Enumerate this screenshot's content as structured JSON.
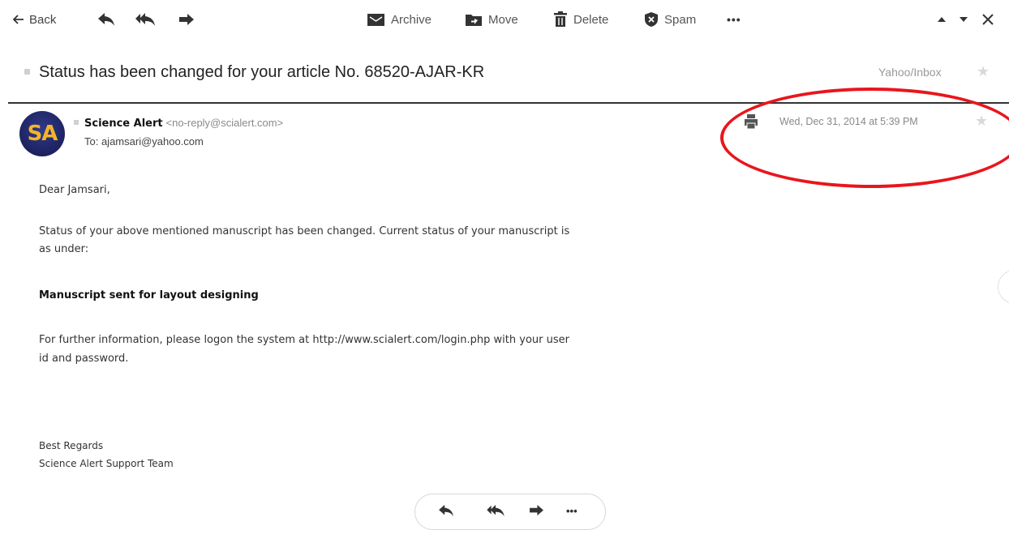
{
  "toolbar": {
    "back_label": "Back",
    "archive_label": "Archive",
    "move_label": "Move",
    "delete_label": "Delete",
    "spam_label": "Spam",
    "more_label": "•••"
  },
  "message": {
    "subject": "Status has been changed for your article No. 68520-AJAR-KR",
    "folder": "Yahoo/Inbox",
    "avatar_initials": "SA",
    "sender_name": "Science Alert",
    "sender_email": "<no-reply@scialert.com>",
    "to": "To: ajamsari@yahoo.com",
    "date": "Wed, Dec 31, 2014 at 5:39 PM"
  },
  "body": {
    "greeting": "Dear Jamsari,",
    "para1_line1": "Status of your above mentioned manuscript has been changed. Current status of your manuscript is",
    "para1_line2": "as under:",
    "status": "Manuscript sent for layout designing",
    "para2_line1": "For further information, please logon the system at http://www.scialert.com/login.php with your user",
    "para2_line2": "id and password.",
    "signoff": "Best Regards",
    "signature": "Science Alert Support Team"
  },
  "reply_bar": {
    "more_label": "•••"
  },
  "colors": {
    "annotation": "#e8161c",
    "icon": "#333333",
    "avatar_bg": "#1d2260",
    "avatar_text": "#f3b32a"
  }
}
